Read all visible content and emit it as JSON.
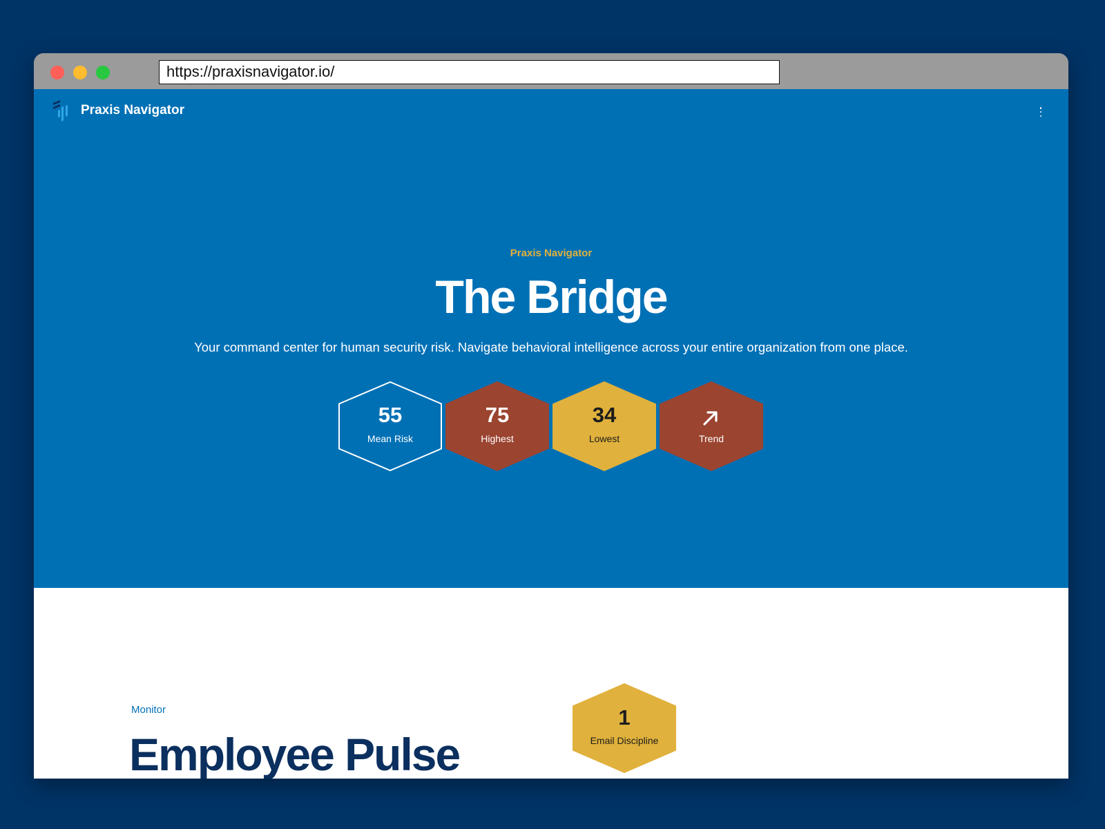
{
  "browser": {
    "url": "https://praxisnavigator.io/"
  },
  "nav": {
    "brand": "Praxis Navigator",
    "logo_icon": "praxis-logo-icon",
    "menu_icon": "kebab-menu-icon"
  },
  "hero": {
    "eyebrow": "Praxis Navigator",
    "title": "The Bridge",
    "subtitle": "Your command center for human security risk. Navigate behavioral intelligence across your entire organization from one place.",
    "stats": [
      {
        "value": "55",
        "label": "Mean Risk",
        "style": "outline"
      },
      {
        "value": "75",
        "label": "Highest",
        "style": "red"
      },
      {
        "value": "34",
        "label": "Lowest",
        "style": "gold"
      },
      {
        "value": "",
        "label": "Trend",
        "style": "red",
        "icon": "arrow-up-right-icon"
      }
    ]
  },
  "monitor": {
    "eyebrow": "Monitor",
    "title": "Employee Pulse",
    "card": {
      "value": "1",
      "label": "Email Discipline"
    }
  },
  "colors": {
    "page_background": "#003366",
    "hero_blue": "#0070b5",
    "accent_gold": "#e0b13c",
    "risk_red": "#9b4430",
    "title_navy": "#0b2f5e"
  }
}
